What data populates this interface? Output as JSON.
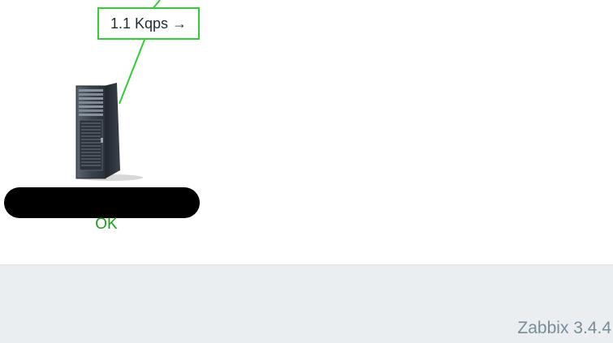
{
  "map": {
    "link": {
      "label": "1.1 Kqps →",
      "color": "#33cc33"
    },
    "host": {
      "icon": "server-icon",
      "name_redacted": true,
      "status": "OK",
      "status_color": "#1a9d1a"
    }
  },
  "footer": {
    "version": "Zabbix 3.4.4"
  }
}
